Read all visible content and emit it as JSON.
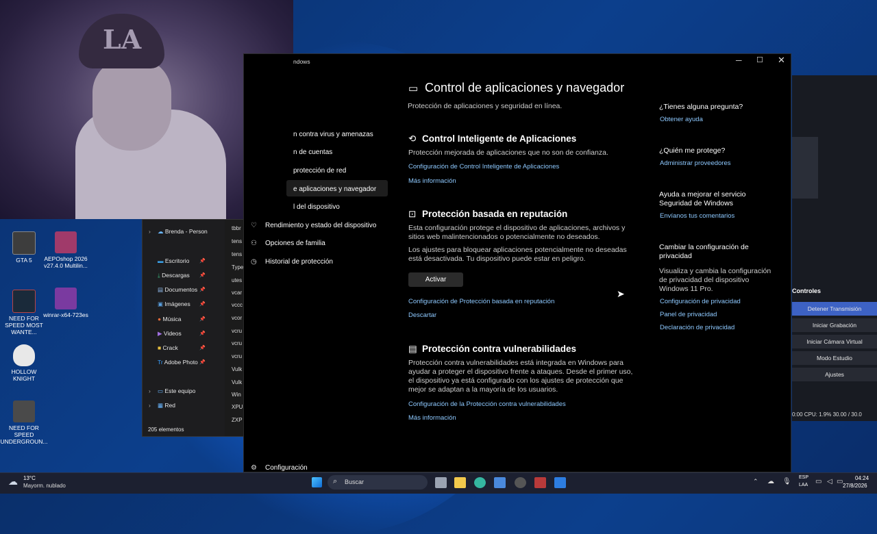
{
  "desktop": {
    "icons": [
      {
        "label": "GTA 5",
        "color": "#3d3d3d"
      },
      {
        "label": "AEPOshop 2026 v27.4.0 Multilin...",
        "color": "#8a2a5a"
      },
      {
        "label": "NEED FOR SPEED MOST WANTE...",
        "color": "#1a2a3a"
      },
      {
        "label": "winrar-x64-723es",
        "color": "#7a3aa0"
      },
      {
        "label": "HOLLOW KNIGHT",
        "color": "#e8e8e8"
      },
      {
        "label": "NEED FOR SPEED UNDERGROUN...",
        "color": "#4a4a4a"
      }
    ]
  },
  "explorer": {
    "nav": [
      {
        "label": "Brenda - Person",
        "pinned": false
      },
      {
        "label": "Escritorio",
        "pinned": true
      },
      {
        "label": "Descargas",
        "pinned": true
      },
      {
        "label": "Documentos",
        "pinned": true
      },
      {
        "label": "Imágenes",
        "pinned": true
      },
      {
        "label": "Música",
        "pinned": true
      },
      {
        "label": "Videos",
        "pinned": true
      },
      {
        "label": "Crack",
        "pinned": true
      },
      {
        "label": "Adobe Photo",
        "pinned": true
      },
      {
        "label": "Este equipo",
        "pinned": false
      },
      {
        "label": "Red",
        "pinned": false
      }
    ],
    "files": [
      "tbbr",
      "tens",
      "tens",
      "Type",
      "utes",
      "vcar",
      "vccc",
      "vcor",
      "vcru",
      "vcru",
      "vcru",
      "Vulk",
      "Vulk",
      "Win",
      "XPU",
      "ZXP"
    ],
    "status": "205 elementos"
  },
  "settings": {
    "window_title": "ndows",
    "nav": [
      "n contra virus y amenazas",
      "n de cuentas",
      "protección de red",
      "e aplicaciones y navegador",
      "l del dispositivo",
      "Rendimiento y estado del dispositivo",
      "Opciones de familia",
      "Historial de protección"
    ],
    "footer_label": "Configuración",
    "page_title": "Control de aplicaciones y navegador",
    "page_subtitle": "Protección de aplicaciones y seguridad en línea.",
    "smart_control": {
      "title": "Control Inteligente de Aplicaciones",
      "desc": "Protección mejorada de aplicaciones que no son de confianza.",
      "link1": "Configuración de Control Inteligente de Aplicaciones",
      "link2": "Más información"
    },
    "reputation": {
      "title": "Protección basada en reputación",
      "desc1": "Esta configuración protege el dispositivo de aplicaciones, archivos y sitios web malintencionados o potencialmente no deseados.",
      "desc2": "Los ajustes para bloquear aplicaciones potencialmente no deseadas está desactivada. Tu dispositivo puede estar en peligro.",
      "button": "Activar",
      "link1": "Configuración de Protección basada en reputación",
      "link2": "Descartar"
    },
    "exploit": {
      "title": "Protección contra vulnerabilidades",
      "desc": "Protección contra vulnerabilidades está integrada en Windows para ayudar a proteger el dispositivo frente a ataques. Desde el primer uso, el dispositivo ya está configurado con los ajustes de protección que mejor se adaptan a la mayoría de los usuarios.",
      "link1": "Configuración de la Protección contra vulnerabilidades",
      "link2": "Más información"
    },
    "side": {
      "q1": "¿Tienes alguna pregunta?",
      "q1_link": "Obtener ayuda",
      "q2": "¿Quién me protege?",
      "q2_link": "Administrar proveedores",
      "q3": "Ayuda a mejorar el servicio Seguridad de Windows",
      "q3_link": "Envíanos tus comentarios",
      "q4": "Cambiar la configuración de privacidad",
      "q4_desc": "Visualiza y cambia la configuración de privacidad del dispositivo Windows 11 Pro.",
      "q4_link1": "Configuración de privacidad",
      "q4_link2": "Panel de privacidad",
      "q4_link3": "Declaración de privacidad"
    }
  },
  "obs": {
    "controls_title": "Controles",
    "buttons": [
      "Detener Transmisión",
      "Iniciar Grabación",
      "Iniciar Cámara Virtual",
      "Modo Estudio",
      "Ajustes"
    ],
    "status": "0:00   CPU: 1.9%   30.00 / 30.0"
  },
  "taskbar": {
    "weather_temp": "13°C",
    "weather_desc": "Mayorm. nublado",
    "search_placeholder": "Buscar",
    "lang1": "ESP",
    "lang2": "LAA",
    "time": "04:24",
    "date": "27/8/2026"
  },
  "colors": {
    "accent": "#8ec9ff",
    "obs_active": "#3d62c4",
    "taskbar": "#1c2030"
  }
}
